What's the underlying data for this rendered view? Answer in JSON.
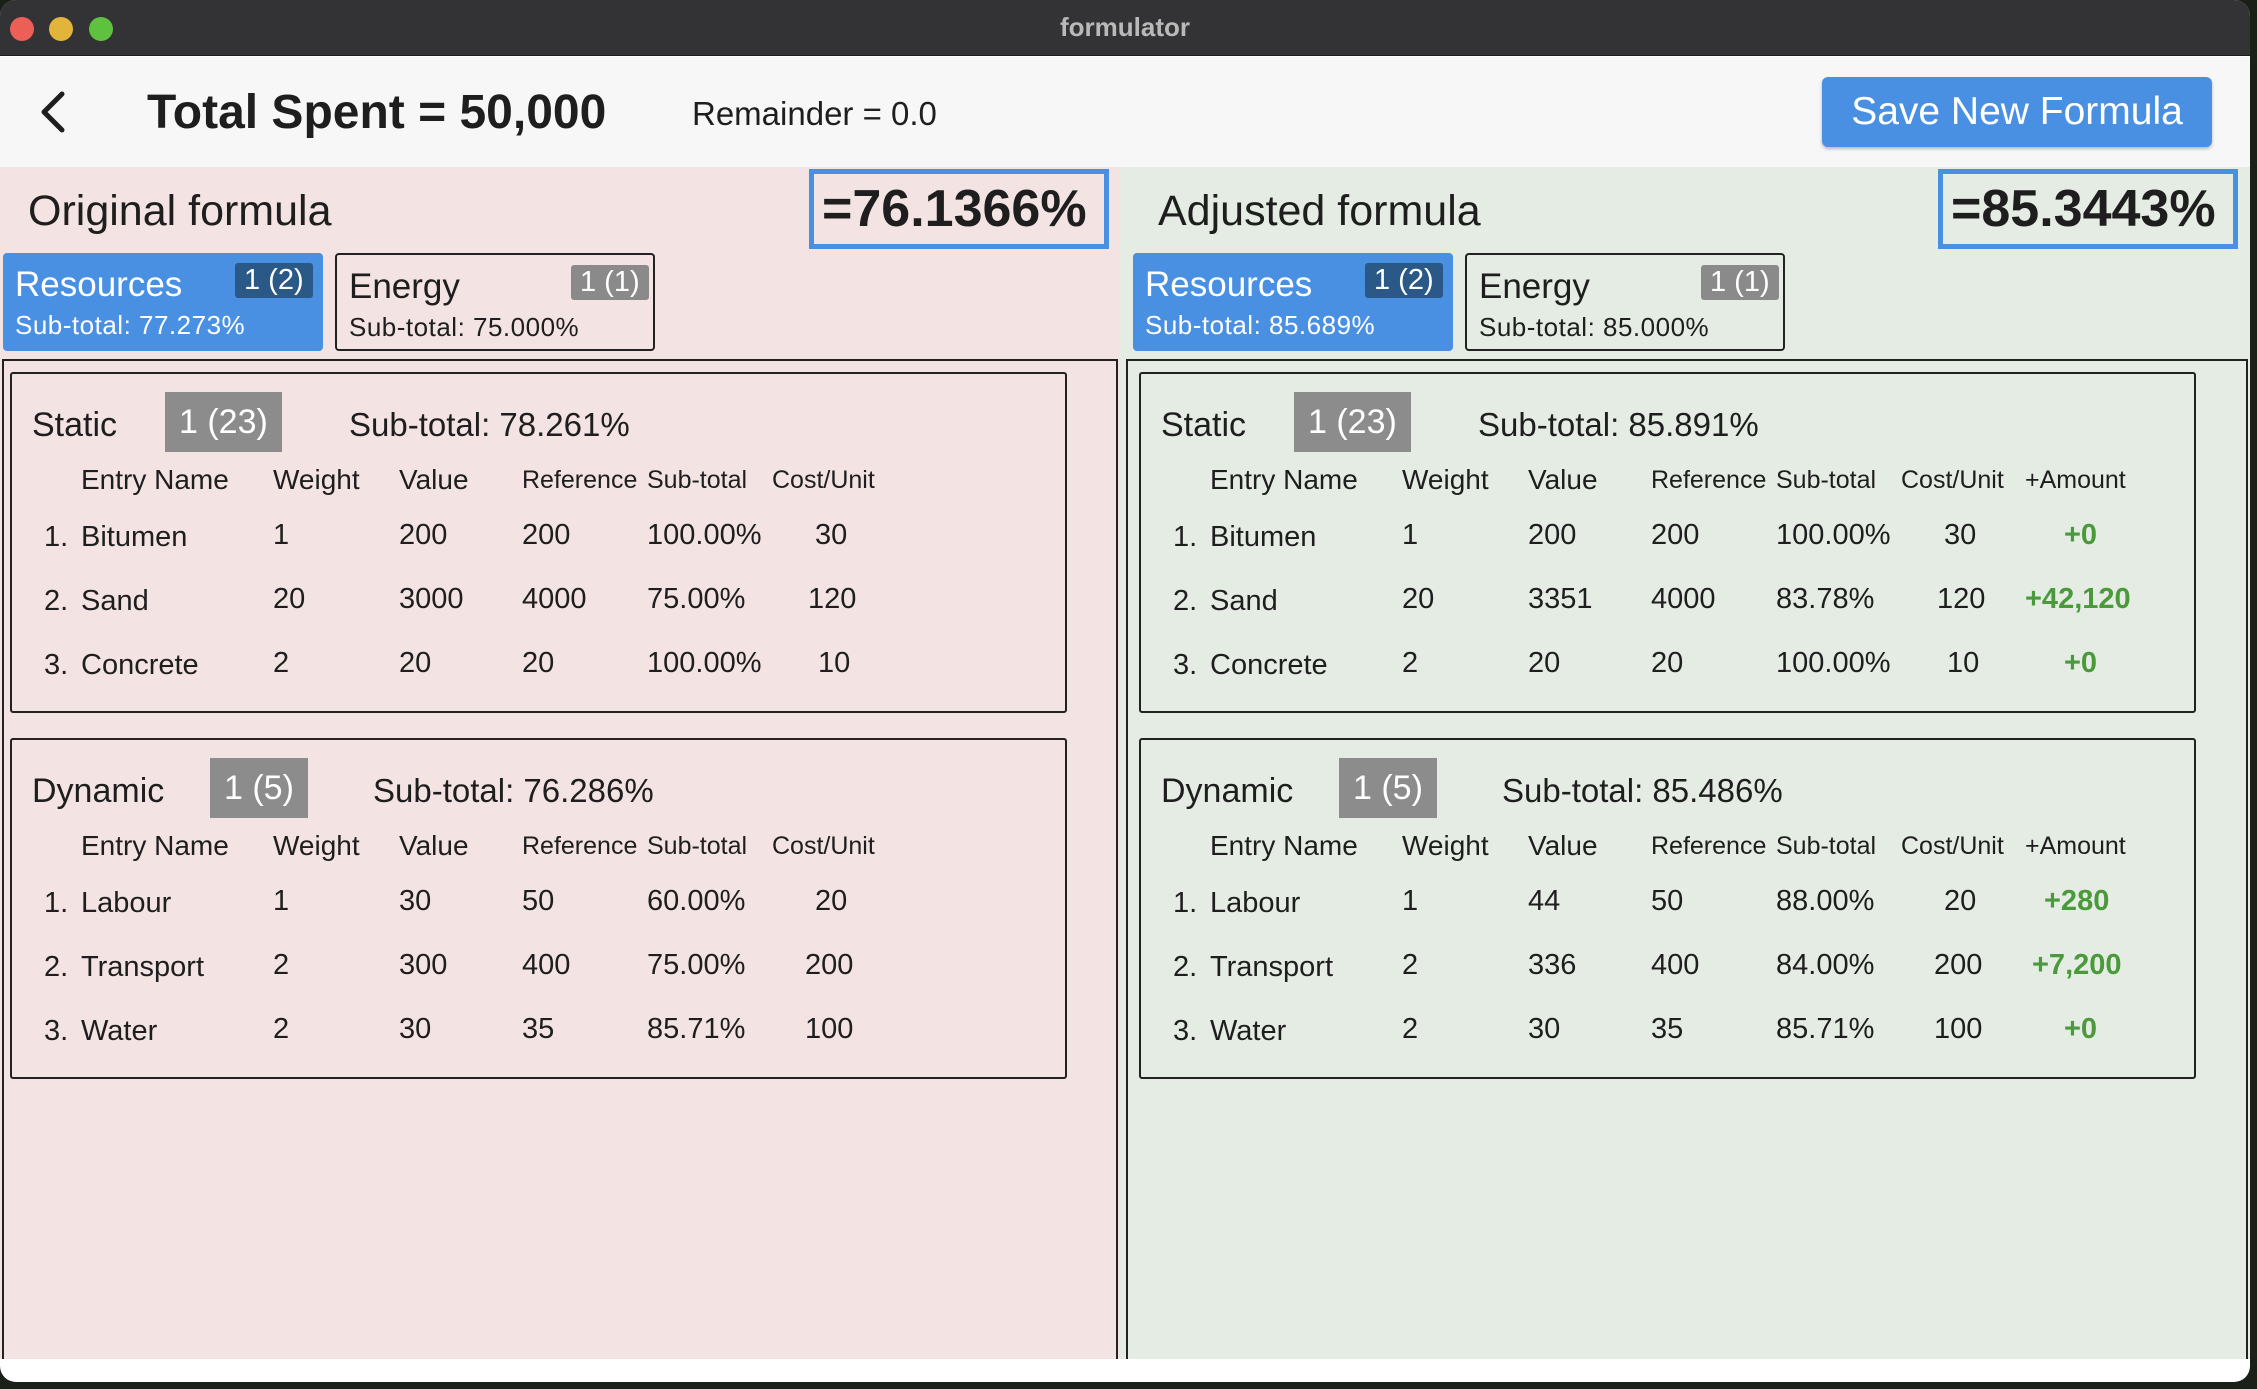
{
  "window": {
    "title": "formulator"
  },
  "header": {
    "total_spent": "Total Spent = 50,000",
    "remainder": "Remainder = 0.0",
    "save_label": "Save New Formula"
  },
  "original": {
    "title": "Original formula",
    "value": "=76.1366%",
    "tabs": [
      {
        "name": "Resources",
        "badge": "1 (2)",
        "subtotal": "Sub-total: 77.273%"
      },
      {
        "name": "Energy",
        "badge": "1 (1)",
        "subtotal": "Sub-total: 75.000%"
      }
    ],
    "sections": [
      {
        "title": "Static",
        "badge": "1 (23)",
        "subtotal": "Sub-total: 78.261%",
        "columns": [
          "Entry Name",
          "Weight",
          "Value",
          "Reference",
          "Sub-total",
          "Cost/Unit"
        ],
        "rows": [
          {
            "num": "1.",
            "name": "Bitumen",
            "weight": "1",
            "value": "200",
            "reference": "200",
            "subtotal": "100.00%",
            "cost": "30"
          },
          {
            "num": "2.",
            "name": "Sand",
            "weight": "20",
            "value": "3000",
            "reference": "4000",
            "subtotal": "75.00%",
            "cost": "120"
          },
          {
            "num": "3.",
            "name": "Concrete",
            "weight": "2",
            "value": "20",
            "reference": "20",
            "subtotal": "100.00%",
            "cost": "10"
          }
        ]
      },
      {
        "title": "Dynamic",
        "badge": "1 (5)",
        "subtotal": "Sub-total: 76.286%",
        "columns": [
          "Entry Name",
          "Weight",
          "Value",
          "Reference",
          "Sub-total",
          "Cost/Unit"
        ],
        "rows": [
          {
            "num": "1.",
            "name": "Labour",
            "weight": "1",
            "value": "30",
            "reference": "50",
            "subtotal": "60.00%",
            "cost": "20"
          },
          {
            "num": "2.",
            "name": "Transport",
            "weight": "2",
            "value": "300",
            "reference": "400",
            "subtotal": "75.00%",
            "cost": "200"
          },
          {
            "num": "3.",
            "name": "Water",
            "weight": "2",
            "value": "30",
            "reference": "35",
            "subtotal": "85.71%",
            "cost": "100"
          }
        ]
      }
    ]
  },
  "adjusted": {
    "title": "Adjusted formula",
    "value": "=85.3443%",
    "tabs": [
      {
        "name": "Resources",
        "badge": "1 (2)",
        "subtotal": "Sub-total: 85.689%"
      },
      {
        "name": "Energy",
        "badge": "1 (1)",
        "subtotal": "Sub-total: 85.000%"
      }
    ],
    "sections": [
      {
        "title": "Static",
        "badge": "1 (23)",
        "subtotal": "Sub-total: 85.891%",
        "columns": [
          "Entry Name",
          "Weight",
          "Value",
          "Reference",
          "Sub-total",
          "Cost/Unit",
          "+Amount"
        ],
        "rows": [
          {
            "num": "1.",
            "name": "Bitumen",
            "weight": "1",
            "value": "200",
            "reference": "200",
            "subtotal": "100.00%",
            "cost": "30",
            "amount": "+0"
          },
          {
            "num": "2.",
            "name": "Sand",
            "weight": "20",
            "value": "3351",
            "reference": "4000",
            "subtotal": "83.78%",
            "cost": "120",
            "amount": "+42,120"
          },
          {
            "num": "3.",
            "name": "Concrete",
            "weight": "2",
            "value": "20",
            "reference": "20",
            "subtotal": "100.00%",
            "cost": "10",
            "amount": "+0"
          }
        ]
      },
      {
        "title": "Dynamic",
        "badge": "1 (5)",
        "subtotal": "Sub-total: 85.486%",
        "columns": [
          "Entry Name",
          "Weight",
          "Value",
          "Reference",
          "Sub-total",
          "Cost/Unit",
          "+Amount"
        ],
        "rows": [
          {
            "num": "1.",
            "name": "Labour",
            "weight": "1",
            "value": "44",
            "reference": "50",
            "subtotal": "88.00%",
            "cost": "20",
            "amount": "+280"
          },
          {
            "num": "2.",
            "name": "Transport",
            "weight": "2",
            "value": "336",
            "reference": "400",
            "subtotal": "84.00%",
            "cost": "200",
            "amount": "+7,200"
          },
          {
            "num": "3.",
            "name": "Water",
            "weight": "2",
            "value": "30",
            "reference": "35",
            "subtotal": "85.71%",
            "cost": "100",
            "amount": "+0"
          }
        ]
      }
    ]
  },
  "colors": {
    "accent": "#4a90e2",
    "original_bg": "#f3e3e2",
    "adjusted_bg": "#e5ece4",
    "amount_green": "#4a9a3c",
    "badge_gray": "#8c8c8c"
  }
}
